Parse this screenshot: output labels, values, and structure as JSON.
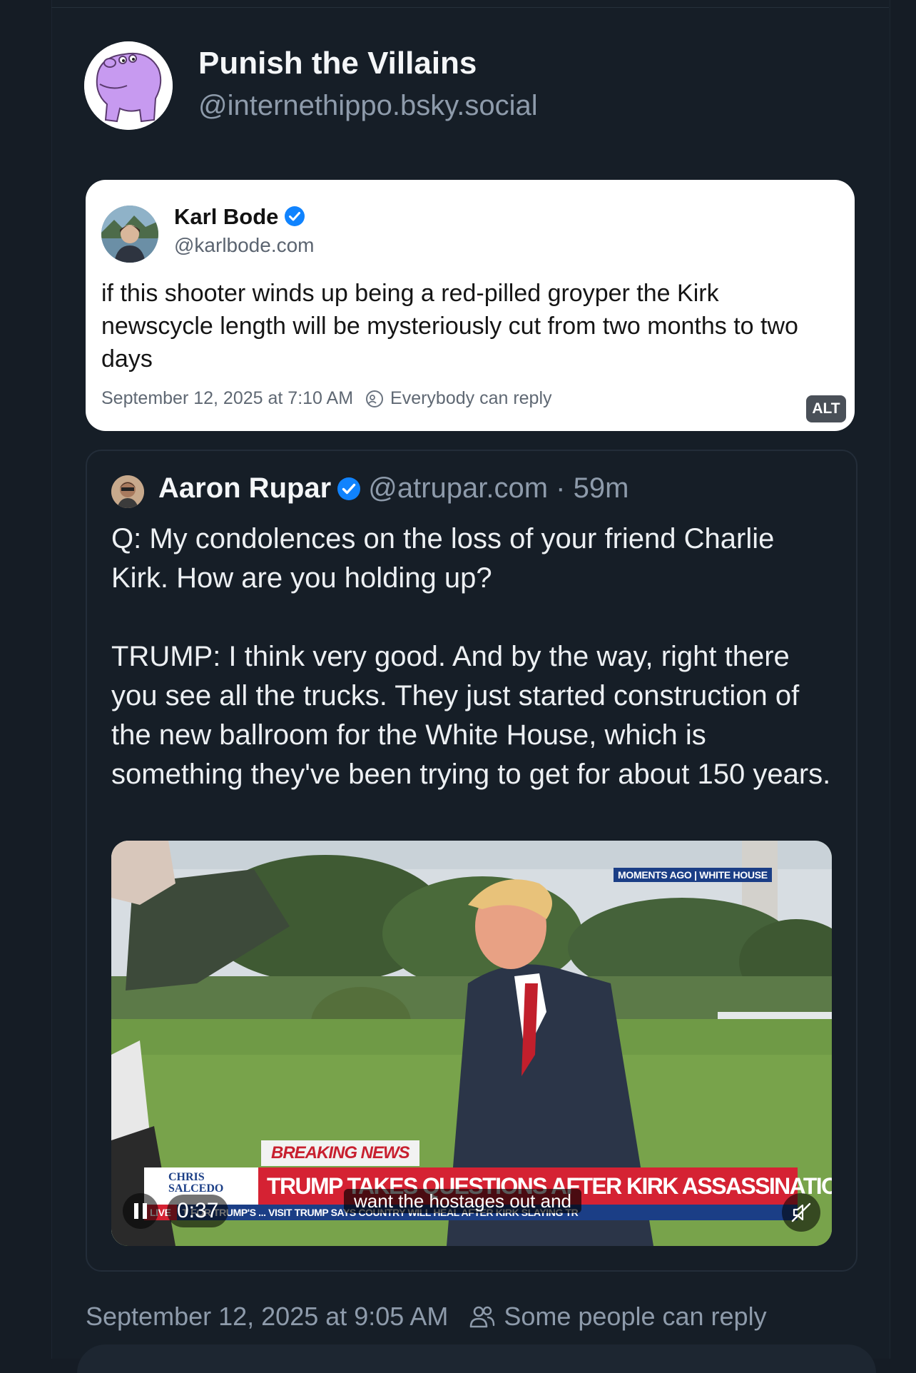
{
  "post": {
    "author_name": "Punish the Villains",
    "author_handle": "@internethippo.bsky.social",
    "timestamp": "September 12, 2025 at 9:05 AM",
    "reply_setting": "Some people can reply"
  },
  "embedded_screenshot": {
    "name": "Karl Bode",
    "handle": "@karlbode.com",
    "text": "if this shooter winds up being a red-pilled groyper the Kirk newscycle length will be mysteriously cut from two months to two days",
    "timestamp": "September 12, 2025 at 7:10 AM",
    "reply_setting": "Everybody can reply",
    "alt_label": "ALT"
  },
  "quoted_post": {
    "name": "Aaron Rupar",
    "handle_time": "@atrupar.com · 59m",
    "paragraph_1": "Q: My condolences on the loss of your friend Charlie Kirk. How are you holding up?",
    "paragraph_2": "TRUMP: I think very good. And by the way, right there you see all the trucks. They just started construction of the new ballroom for the White House, which is something they've been trying to get for about 150 years."
  },
  "video": {
    "moments_tag": "MOMENTS AGO | WHITE HOUSE",
    "breaking_label": "BREAKING NEWS",
    "headline": "TRUMP TAKES QUESTIONS AFTER KIRK ASSASSINATION",
    "logo_text": "CHRIS SALCEDO",
    "live_label": "LIVE",
    "ticker": "T FOR TRUMP'S ... VISIT    TRUMP SAYS COUNTRY WILL HEAL AFTER KIRK SLAYING    TR",
    "caption": "want the hostages out and",
    "time": "0:37"
  },
  "colors": {
    "background": "#161e27",
    "accent_blue": "#1083fe",
    "chyron_red": "#d52233",
    "chyron_blue": "#1b3e86"
  },
  "icons": [
    "hippo-avatar",
    "verified-icon",
    "reply-setting-icon",
    "pause-icon",
    "mute-icon",
    "people-icon"
  ]
}
